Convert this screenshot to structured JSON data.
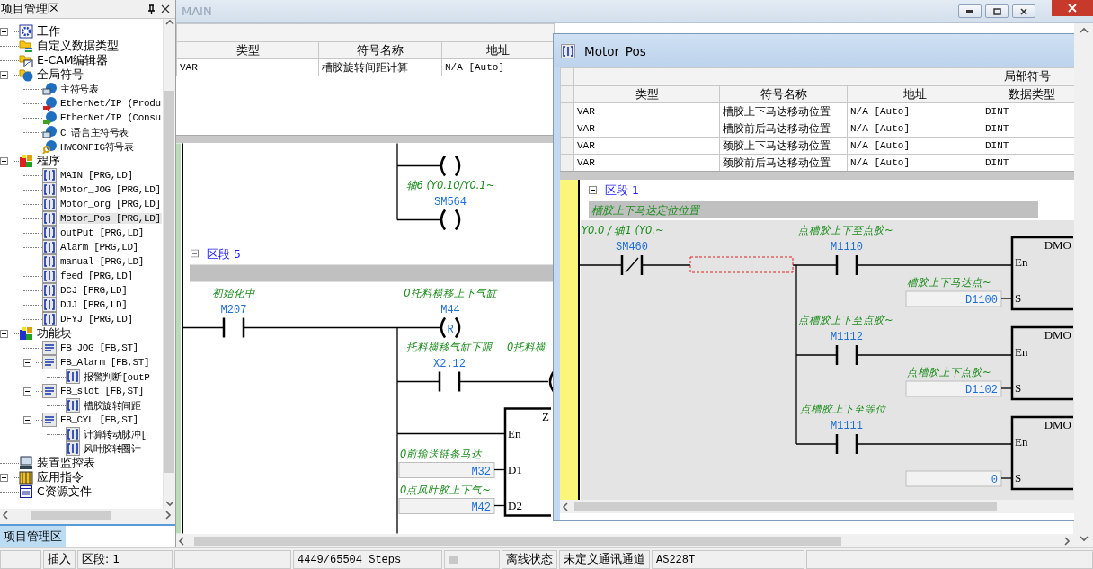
{
  "project_panel": {
    "title": "项目管理区",
    "tree": [
      {
        "label": "工作",
        "kind": "gear",
        "expanded": false,
        "selected": false
      },
      {
        "label": "自定义数据类型",
        "kind": "datatype",
        "selected": false
      },
      {
        "label": "E-CAM编辑器",
        "kind": "cam",
        "selected": false
      },
      {
        "label": "全局符号",
        "kind": "globe",
        "expanded": true,
        "selected": false,
        "children": [
          {
            "label": "主符号表",
            "kind": "table",
            "selected": false
          },
          {
            "label": "EtherNet/IP (Produ",
            "kind": "produce",
            "selected": false
          },
          {
            "label": "EtherNet/IP (Consu",
            "kind": "consume",
            "selected": false
          },
          {
            "label": "C 语言主符号表",
            "kind": "ctable",
            "selected": false
          },
          {
            "label": "HWCONFIG符号表",
            "kind": "key",
            "selected": false
          }
        ]
      },
      {
        "label": "程序",
        "kind": "blocks",
        "expanded": true,
        "selected": false,
        "children": [
          {
            "label": "MAIN [PRG,LD]",
            "kind": "ld",
            "selected": false
          },
          {
            "label": "Motor_JOG [PRG,LD]",
            "kind": "ld",
            "selected": false
          },
          {
            "label": "Motor_org [PRG,LD]",
            "kind": "ld",
            "selected": false
          },
          {
            "label": "Motor_Pos [PRG,LD]",
            "kind": "ld",
            "selected": true
          },
          {
            "label": "outPut [PRG,LD]",
            "kind": "ld",
            "selected": false
          },
          {
            "label": "Alarm [PRG,LD]",
            "kind": "ld",
            "selected": false
          },
          {
            "label": "manual [PRG,LD]",
            "kind": "ld",
            "selected": false
          },
          {
            "label": "feed [PRG,LD]",
            "kind": "ld",
            "selected": false
          },
          {
            "label": "DCJ [PRG,LD]",
            "kind": "ld",
            "selected": false
          },
          {
            "label": "DJJ [PRG,LD]",
            "kind": "ld",
            "selected": false
          },
          {
            "label": "DFYJ [PRG,LD]",
            "kind": "ld",
            "selected": false
          }
        ]
      },
      {
        "label": "功能块",
        "kind": "fblocks",
        "expanded": true,
        "selected": false,
        "children": [
          {
            "label": "FB_JOG [FB,ST]",
            "kind": "st",
            "selected": false
          },
          {
            "label": "FB_Alarm [FB,ST]",
            "kind": "st",
            "expanded": true,
            "selected": false,
            "children": [
              {
                "label": "报警判断[outP",
                "kind": "instance",
                "selected": false
              }
            ]
          },
          {
            "label": "FB_slot [FB,ST]",
            "kind": "st",
            "expanded": true,
            "selected": false,
            "children": [
              {
                "label": "槽胶旋转间距",
                "kind": "instance",
                "selected": false
              }
            ]
          },
          {
            "label": "FB_CYL [FB,ST]",
            "kind": "st",
            "expanded": true,
            "selected": false,
            "children": [
              {
                "label": "计算转动脉冲[",
                "kind": "instance",
                "selected": false
              },
              {
                "label": "风叶胶转圈计",
                "kind": "instance",
                "selected": false
              }
            ]
          }
        ]
      },
      {
        "label": "装置监控表",
        "kind": "monitor",
        "selected": false
      },
      {
        "label": "应用指令",
        "kind": "instruction",
        "expanded": false,
        "selected": false
      },
      {
        "label": "C资源文件",
        "kind": "cfile",
        "selected": false
      }
    ],
    "tabs": [
      {
        "label": "项目管理区",
        "selected": true
      }
    ]
  },
  "main_window": {
    "title": "MAIN",
    "active": false,
    "symbols": {
      "columns": [
        "类型",
        "符号名称",
        "地址"
      ],
      "rows": [
        [
          "VAR",
          "槽胶旋转间距计算",
          "N/A [Auto]"
        ]
      ]
    },
    "ladder": {
      "upper": [
        {
          "kind": "coil"
        },
        {
          "kind": "coil",
          "comment": "轴6 (Y0.10/Y0.1~",
          "device": "SM564"
        }
      ],
      "section": {
        "label": "区段 5",
        "expanded": true
      },
      "rung": [
        {
          "kind": "contact",
          "comment": "初始化中",
          "device": "M207"
        },
        {
          "kind": "reset_coil",
          "comment": "0托料横移上下气缸",
          "device": "M44",
          "symbol": "R"
        },
        {
          "kind": "contact",
          "comment": "托料横移气缸下限",
          "device": "X2.12"
        },
        {
          "kind": "coil",
          "comment": "0托料横"
        },
        {
          "kind": "function_box",
          "name": "Z",
          "pins": [
            {
              "pin": "En"
            },
            {
              "pin": "D1",
              "comment": "0前输送链条马达",
              "operand": "M32"
            },
            {
              "pin": "D2",
              "comment": "0点风叶胶上下气~",
              "operand": "M42"
            }
          ]
        }
      ]
    }
  },
  "motor_window": {
    "title": "Motor_Pos",
    "active": true,
    "symbols": {
      "title": "局部符号",
      "columns": [
        "类型",
        "符号名称",
        "地址",
        "数据类型"
      ],
      "rows": [
        [
          "VAR",
          "槽胶上下马达移动位置",
          "N/A [Auto]",
          "DINT"
        ],
        [
          "VAR",
          "槽胶前后马达移动位置",
          "N/A [Auto]",
          "DINT"
        ],
        [
          "VAR",
          "颈胶上下马达移动位置",
          "N/A [Auto]",
          "DINT"
        ],
        [
          "VAR",
          "颈胶前后马达移动位置",
          "N/A [Auto]",
          "DINT"
        ]
      ]
    },
    "ladder": {
      "section": {
        "label": "区段 1",
        "expanded": true
      },
      "comment": "槽胶上下马达定位位置",
      "rung": [
        {
          "kind": "contact_nc",
          "comment": "Y0.0 / 轴1 (Y0.~",
          "device": "SM460"
        },
        {
          "kind": "cursor"
        },
        {
          "kind": "contact",
          "comment": "点槽胶上下至点胶~",
          "device": "M1110"
        },
        {
          "kind": "function_box",
          "name": "DMO",
          "pins": [
            {
              "pin": "En"
            },
            {
              "pin": "S",
              "comment": "槽胶上下马达点~",
              "operand": "D1100"
            }
          ]
        },
        {
          "kind": "contact",
          "comment": "点槽胶上下至点胶~",
          "device": "M1112"
        },
        {
          "kind": "function_box",
          "name": "DMO",
          "pins": [
            {
              "pin": "En"
            },
            {
              "pin": "S",
              "comment": "点槽胶上下点胶~",
              "operand": "D1102"
            }
          ]
        },
        {
          "kind": "contact",
          "comment": "点槽胶上下至等位",
          "device": "M1111"
        },
        {
          "kind": "function_box",
          "name": "DMO",
          "pins": [
            {
              "pin": "En"
            },
            {
              "pin": "S",
              "operand": "0"
            }
          ]
        }
      ]
    }
  },
  "status_bar": {
    "mode": "插入",
    "section": "区段:  1",
    "steps": "4449/65504 Steps",
    "state": "离线状态",
    "channel": "未定义通讯通道",
    "model": "AS228T"
  }
}
